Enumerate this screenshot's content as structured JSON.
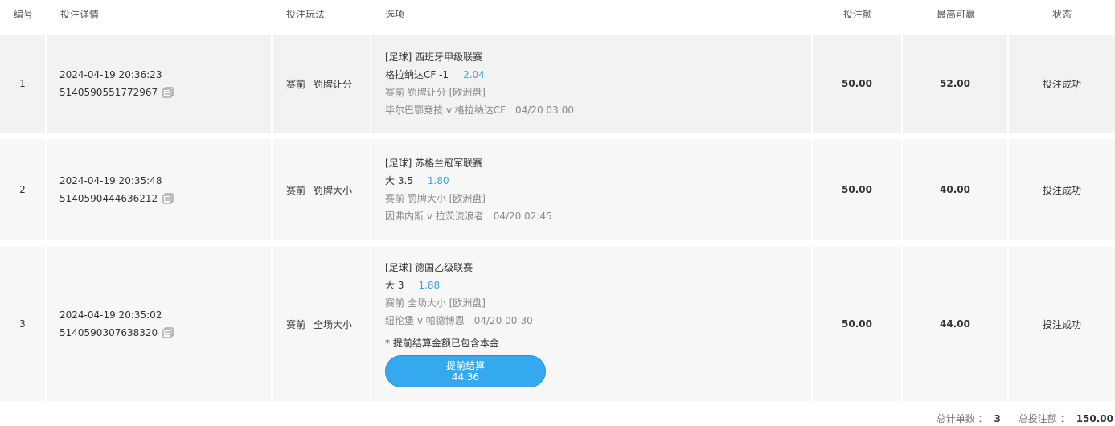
{
  "headers": {
    "no": "编号",
    "detail": "投注详情",
    "play": "投注玩法",
    "option": "选项",
    "amount": "投注额",
    "max_win": "最高可赢",
    "status": "状态"
  },
  "rows": [
    {
      "no": "1",
      "time": "2024-04-19 20:36:23",
      "bet_id": "5140590551772967",
      "play_stage": "赛前",
      "play_type": "罚牌让分",
      "league": "[足球] 西班牙甲级联赛",
      "selection": "格拉纳达CF -1",
      "odds": "2.04",
      "market": "赛前 罚牌让分 [欧洲盘]",
      "match": "毕尔巴鄂竞技 v 格拉纳达CF",
      "match_time": "04/20 03:00",
      "amount": "50.00",
      "max_win": "52.00",
      "status": "投注成功"
    },
    {
      "no": "2",
      "time": "2024-04-19 20:35:48",
      "bet_id": "5140590444636212",
      "play_stage": "赛前",
      "play_type": "罚牌大小",
      "league": "[足球] 苏格兰冠军联赛",
      "selection": "大 3.5",
      "odds": "1.80",
      "market": "赛前 罚牌大小 [欧洲盘]",
      "match": "因弗内斯 v 拉茨流浪者",
      "match_time": "04/20 02:45",
      "amount": "50.00",
      "max_win": "40.00",
      "status": "投注成功"
    },
    {
      "no": "3",
      "time": "2024-04-19 20:35:02",
      "bet_id": "5140590307638320",
      "play_stage": "赛前",
      "play_type": "全场大小",
      "league": "[足球] 德国乙级联赛",
      "selection": "大 3",
      "odds": "1.88",
      "market": "赛前 全场大小 [欧洲盘]",
      "match": "纽伦堡 v 帕德博恩",
      "match_time": "04/20 00:30",
      "note": "* 提前结算金额已包含本金",
      "cashout_label": "提前结算",
      "cashout_value": "44.36",
      "amount": "50.00",
      "max_win": "44.00",
      "status": "投注成功"
    }
  ],
  "summary": {
    "count_label": "总计单数 ：",
    "count": "3",
    "total_label": "总投注额 ：",
    "total": "150.00"
  },
  "colors": {
    "odds": "#3aa4e0",
    "cashout_button": "#35a9f0",
    "row_bg": "#f2f2f2"
  },
  "icons": {
    "copy": "copy-icon"
  }
}
